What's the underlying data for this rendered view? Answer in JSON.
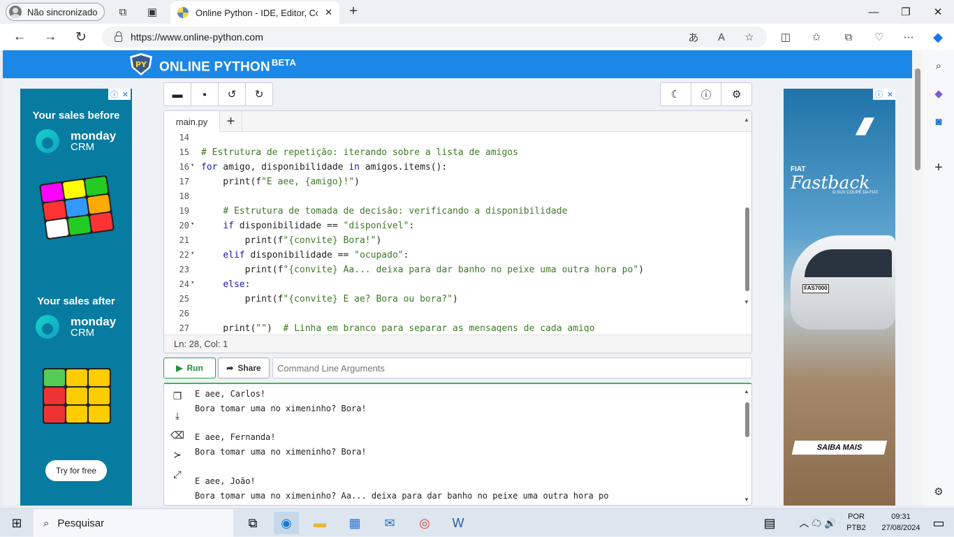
{
  "browser": {
    "profile_label": "Não sincronizado",
    "tab_title": "Online Python - IDE, Editor, Compiler",
    "url": "https://www.online-python.com"
  },
  "site": {
    "brand": "ONLINE PYTHON",
    "brand_sup": "BETA",
    "logo_text": "PY"
  },
  "ads": {
    "left_before": "Your sales before",
    "left_after": "Your sales after",
    "monday": "monday",
    "crm": "CRM",
    "try_free": "Try for free",
    "right_brand": "FIAT",
    "right_model": "Fastback",
    "right_tag": "O SUV COUPÉ DA FIAT.",
    "right_plate": "FAS7000",
    "right_cta": "SAIBA MAIS"
  },
  "editor": {
    "file_tab": "main.py",
    "status": "Ln: 28,  Col: 1",
    "lines": [
      {
        "n": "14",
        "t": ""
      },
      {
        "n": "15",
        "t": "# Estrutura de repetição: iterando sobre a lista de amigos"
      },
      {
        "n": "16",
        "t": "for amigo, disponibilidade in amigos.items():"
      },
      {
        "n": "17",
        "t": "    print(f\"E aee, {amigo}!\")"
      },
      {
        "n": "18",
        "t": ""
      },
      {
        "n": "19",
        "t": "    # Estrutura de tomada de decisão: verificando a disponibilidade"
      },
      {
        "n": "20",
        "t": "    if disponibilidade == \"disponível\":"
      },
      {
        "n": "21",
        "t": "        print(f\"{convite} Bora!\")"
      },
      {
        "n": "22",
        "t": "    elif disponibilidade == \"ocupado\":"
      },
      {
        "n": "23",
        "t": "        print(f\"{convite} Aa... deixa para dar banho no peixe uma outra hora po\")"
      },
      {
        "n": "24",
        "t": "    else:"
      },
      {
        "n": "25",
        "t": "        print(f\"{convite} E ae? Bora ou bora?\")"
      },
      {
        "n": "26",
        "t": ""
      },
      {
        "n": "27",
        "t": "    print(\"\")  # Linha em branco para separar as mensagens de cada amigo"
      }
    ]
  },
  "run": {
    "run_label": "Run",
    "share_label": "Share",
    "args_placeholder": "Command Line Arguments"
  },
  "console": {
    "lines": [
      "E aee, Carlos!",
      "Bora tomar uma no ximeninho? Bora!",
      "",
      "E aee, Fernanda!",
      "Bora tomar uma no ximeninho? Bora!",
      "",
      "E aee, João!",
      "Bora tomar uma no ximeninho? Aa... deixa para dar banho no peixe uma outra hora po"
    ]
  },
  "taskbar": {
    "search": "Pesquisar",
    "lang1": "POR",
    "lang2": "PTB2",
    "time": "09:31",
    "date": "27/08/2024"
  }
}
